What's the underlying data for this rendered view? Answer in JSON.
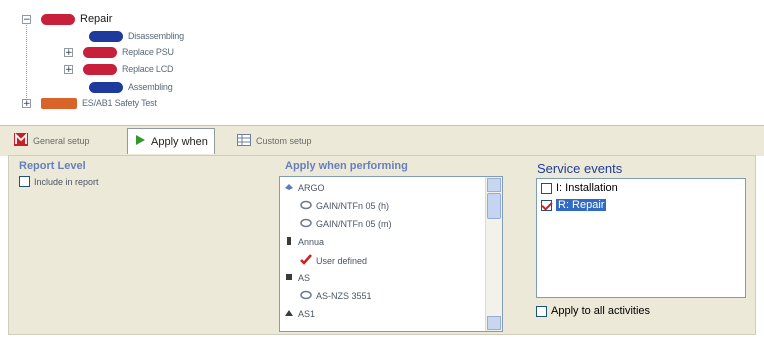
{
  "tree": {
    "nodes": [
      {
        "label": "Repair",
        "color": "#c8203a",
        "expander": "−"
      },
      {
        "label": "Disassembling",
        "color": "#1d3a9c"
      },
      {
        "label": "Replace PSU",
        "color": "#c8203a",
        "expander": "+"
      },
      {
        "label": "Replace LCD",
        "color": "#c8203a",
        "expander": "+"
      },
      {
        "label": "Assembling",
        "color": "#1d3a9c"
      },
      {
        "label": "ES/AB1 Safety Test",
        "color": "#d8642a",
        "expander": "+"
      }
    ]
  },
  "tabs": [
    {
      "label": "General setup",
      "icon": "m-icon"
    },
    {
      "label": "Apply when",
      "icon": "play-icon"
    },
    {
      "label": "Custom setup",
      "icon": "grid-icon"
    }
  ],
  "panel": {
    "report_level": {
      "title": "Report Level",
      "include_label": "Include in report"
    },
    "apply_when": {
      "title": "Apply when performing",
      "items": [
        {
          "label": "ARGO",
          "icon": "device-icon"
        },
        {
          "label": "GAIN/NTFn 05 (h)",
          "icon": "gear-icon"
        },
        {
          "label": "GAIN/NTFn 05 (m)",
          "icon": "gear-icon"
        },
        {
          "label": "Annua",
          "icon": "device-icon"
        },
        {
          "label": "User defined",
          "icon": "check-icon"
        },
        {
          "label": "AS",
          "icon": "device-icon"
        },
        {
          "label": "AS-NZS 3551",
          "icon": "gear-icon"
        },
        {
          "label": "AS1",
          "icon": "device-icon"
        }
      ]
    },
    "service_events": {
      "title": "Service events",
      "items": [
        {
          "label": "I: Installation",
          "checked": false,
          "selected": false
        },
        {
          "label": "R: Repair",
          "checked": true,
          "selected": true
        }
      ],
      "apply_all_label": "Apply to all activities"
    }
  },
  "colors": {
    "accent": "#316ac5",
    "panel_bg": "#ece9d8",
    "title_blue": "#3a5cb5"
  }
}
